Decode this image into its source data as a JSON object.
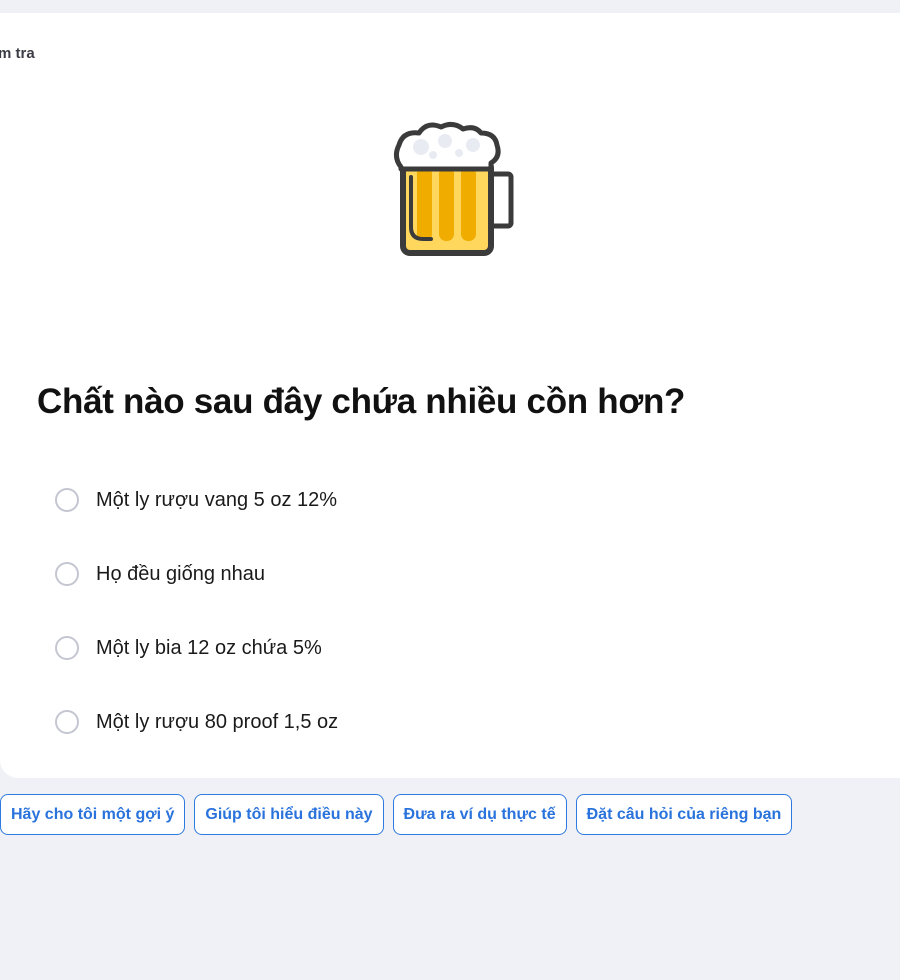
{
  "card": {
    "label": "m tra",
    "illustration": "beer-mug-icon"
  },
  "quiz": {
    "question": "Chất nào sau đây chứa nhiều cồn hơn?",
    "options": [
      {
        "label": "Một ly rượu vang 5 oz 12%",
        "selected": false
      },
      {
        "label": "Họ đều giống nhau",
        "selected": false
      },
      {
        "label": "Một ly bia 12 oz chứa 5%",
        "selected": false
      },
      {
        "label": "Một ly rượu 80 proof 1,5 oz",
        "selected": false
      }
    ]
  },
  "suggestions": [
    {
      "label": "Hãy cho tôi một gợi ý"
    },
    {
      "label": "Giúp tôi hiểu điều này"
    },
    {
      "label": "Đưa ra ví dụ thực tế"
    },
    {
      "label": "Đặt câu hỏi của riêng bạn"
    }
  ],
  "colors": {
    "background": "#f0f1f6",
    "card": "#ffffff",
    "accent": "#2a73dc",
    "radio_border": "#c4c6d2",
    "beer": "#f0ad00",
    "beer_light": "#ffd75c",
    "outline": "#3b3b3b"
  }
}
